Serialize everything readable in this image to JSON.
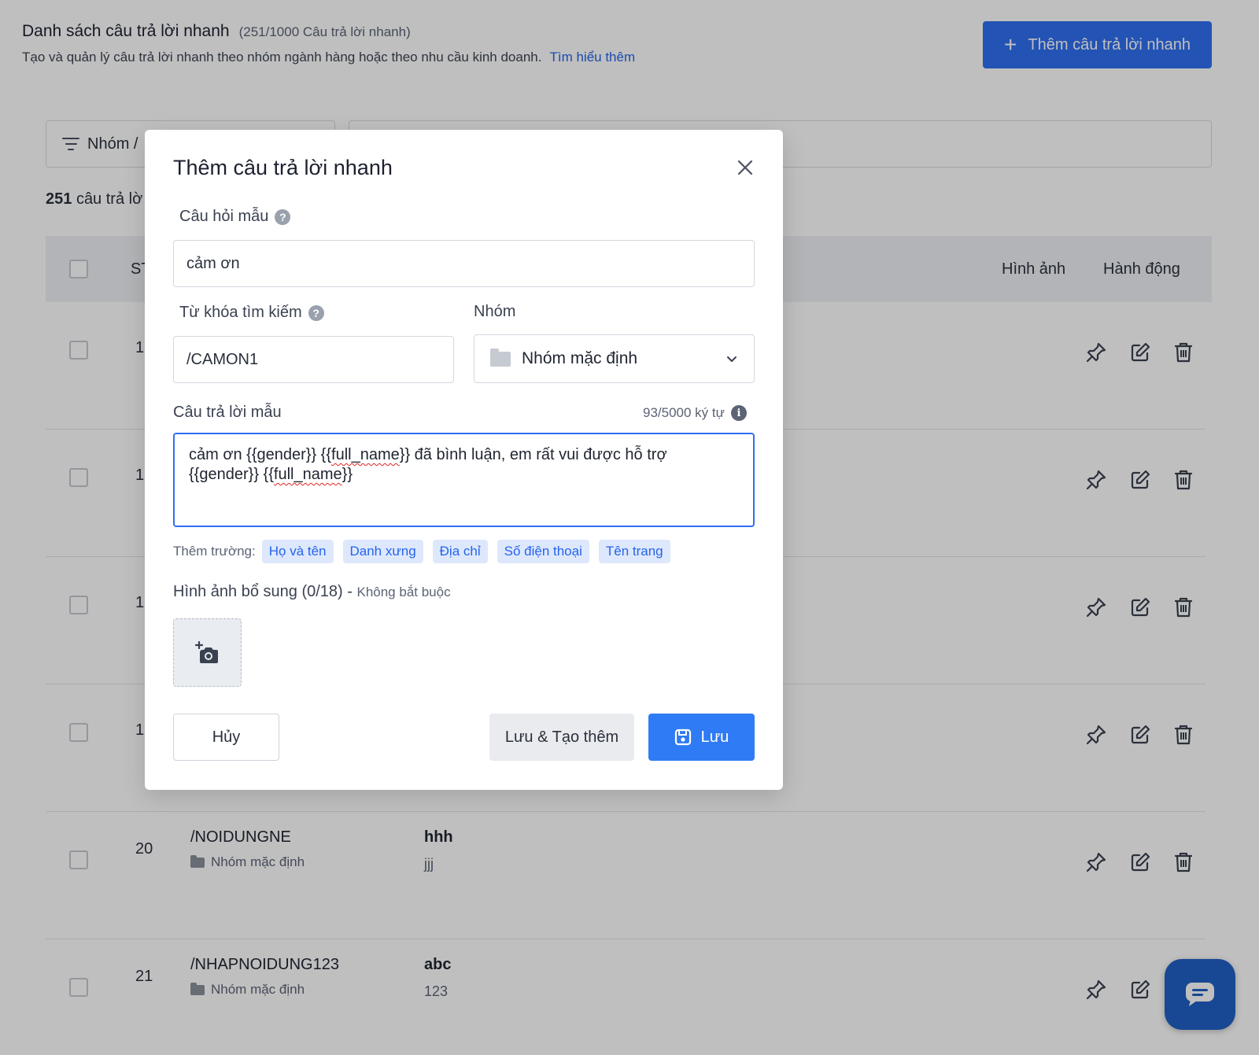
{
  "page": {
    "title": "Danh sách câu trả lời nhanh",
    "count": "(251/1000 Câu trả lời nhanh)",
    "description": "Tạo và quản lý câu trả lời nhanh theo nhóm ngành hàng hoặc theo nhu cầu kinh doanh.",
    "learn_more": "Tìm hiểu thêm",
    "add_button": "Thêm câu trả lời nhanh",
    "filter_label": "Nhóm /",
    "result_count_number": "251",
    "result_count_text": "câu trả lờ"
  },
  "table": {
    "headers": {
      "stt": "ST",
      "image": "Hình ảnh",
      "actions": "Hành động"
    },
    "partial_rows": [
      "1",
      "1",
      "1",
      "1"
    ],
    "rows": [
      {
        "stt": "20",
        "keyword": "/NOIDUNGNE",
        "group": "Nhóm mặc định",
        "question": "hhh",
        "answer": "jjj"
      },
      {
        "stt": "21",
        "keyword": "/NHAPNOIDUNG123",
        "group": "Nhóm mặc định",
        "question": "abc",
        "answer": "123"
      }
    ]
  },
  "modal": {
    "title": "Thêm câu trả lời nhanh",
    "question_label": "Câu hỏi mẫu",
    "question_value": "cảm ơn",
    "keyword_label": "Từ khóa tìm kiếm",
    "keyword_value": "/CAMON1",
    "group_label": "Nhóm",
    "group_value": "Nhóm mặc định",
    "answer_label": "Câu trả lời mẫu",
    "answer_counter": "93/5000 ký tự",
    "answer_parts": {
      "p1": "cảm ơn {{gender}} {{",
      "s1": "full_name",
      "p2": "}} đã bình luận, em rất vui được hỗ trợ",
      "p3": "{{gender}} {{",
      "s2": "full_name",
      "p4": "}}"
    },
    "fields_label": "Thêm trường:",
    "fields": [
      "Họ và tên",
      "Danh xưng",
      "Địa chỉ",
      "Số điện thoại",
      "Tên trang"
    ],
    "images_label": "Hình ảnh bổ sung (0/18) -",
    "images_optional": "Không bắt buộc",
    "cancel": "Hủy",
    "save_more": "Lưu & Tạo thêm",
    "save": "Lưu"
  },
  "colors": {
    "primary": "#2f6ff0",
    "save": "#2f7bf5",
    "chip_bg": "#dde8fd",
    "chat_fab": "#2160c4"
  }
}
